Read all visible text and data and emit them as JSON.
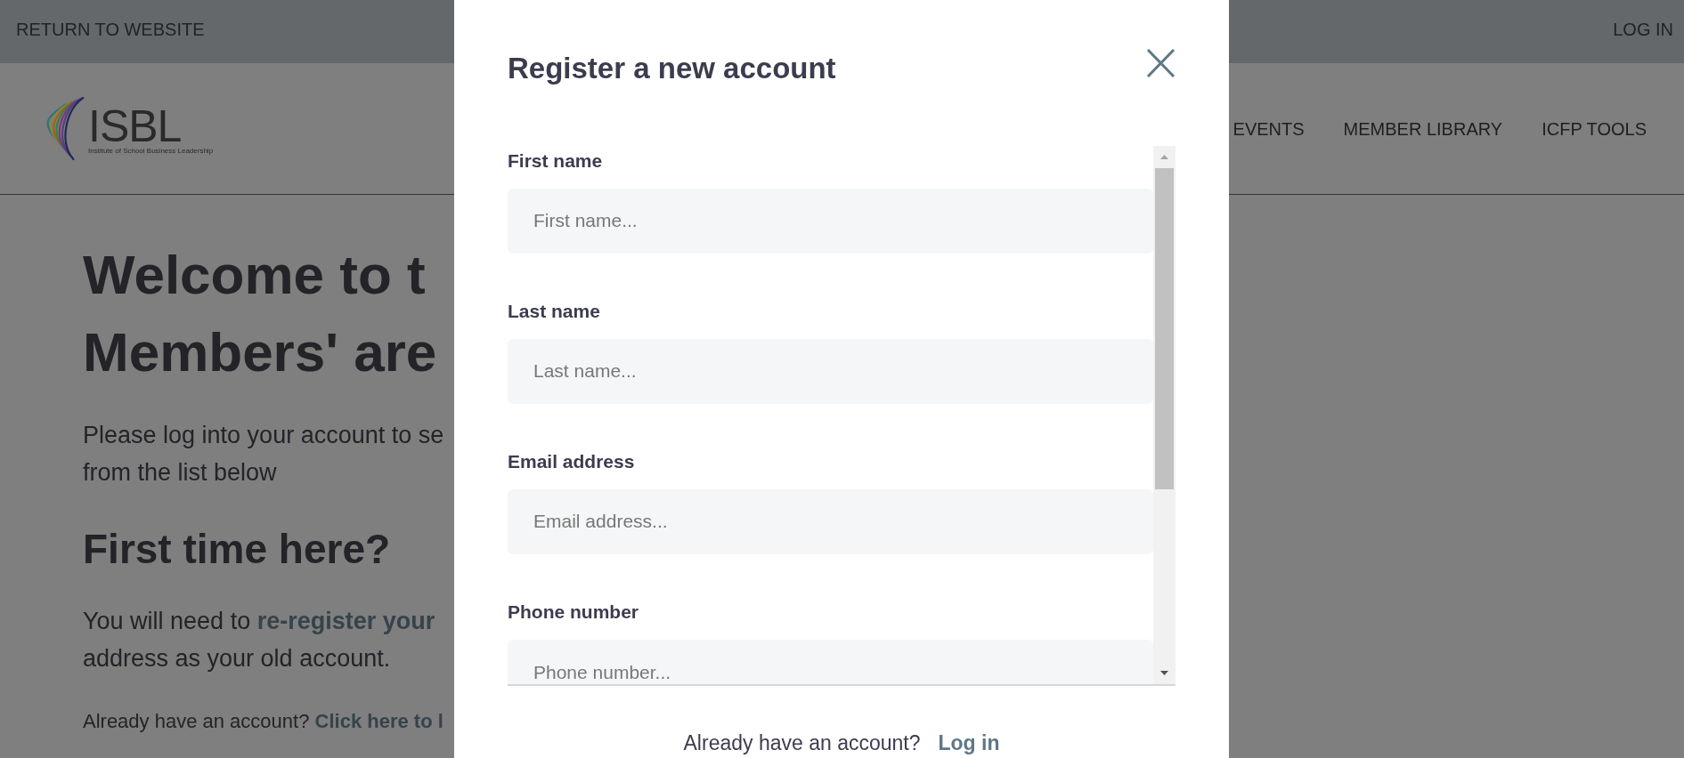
{
  "top_bar": {
    "return_link": "RETURN TO WEBSITE",
    "login_link": "LOG IN"
  },
  "header": {
    "logo": {
      "wordmark": "ISBL",
      "caption": "Institute of School Business Leadership"
    },
    "nav": [
      {
        "label": "EVENTS"
      },
      {
        "label": "MEMBER LIBRARY"
      },
      {
        "label": "ICFP TOOLS"
      }
    ]
  },
  "main": {
    "heading_lines": [
      "Welcome to t",
      "Members' are"
    ],
    "intro_lines": [
      "Please log into your account to se",
      "from the list below"
    ],
    "subheading": "First time here?",
    "register_note": [
      [
        {
          "kind": "text",
          "text": "You will need to"
        },
        {
          "kind": "link",
          "text": "re-register your"
        }
      ],
      [
        {
          "kind": "text",
          "text": "address as your old account."
        }
      ]
    ],
    "login_note": [
      {
        "kind": "text",
        "text": "Already have an account?"
      },
      {
        "kind": "link",
        "text": "Click here to l"
      }
    ]
  },
  "modal": {
    "title": "Register a new account",
    "fields": [
      {
        "label": "First name",
        "placeholder": "First name..."
      },
      {
        "label": "Last name",
        "placeholder": "Last name..."
      },
      {
        "label": "Email address",
        "placeholder": "Email address..."
      },
      {
        "label": "Phone number",
        "placeholder": "Phone number..."
      }
    ],
    "footer": {
      "prompt": "Already have an account?",
      "link": "Log in"
    }
  }
}
